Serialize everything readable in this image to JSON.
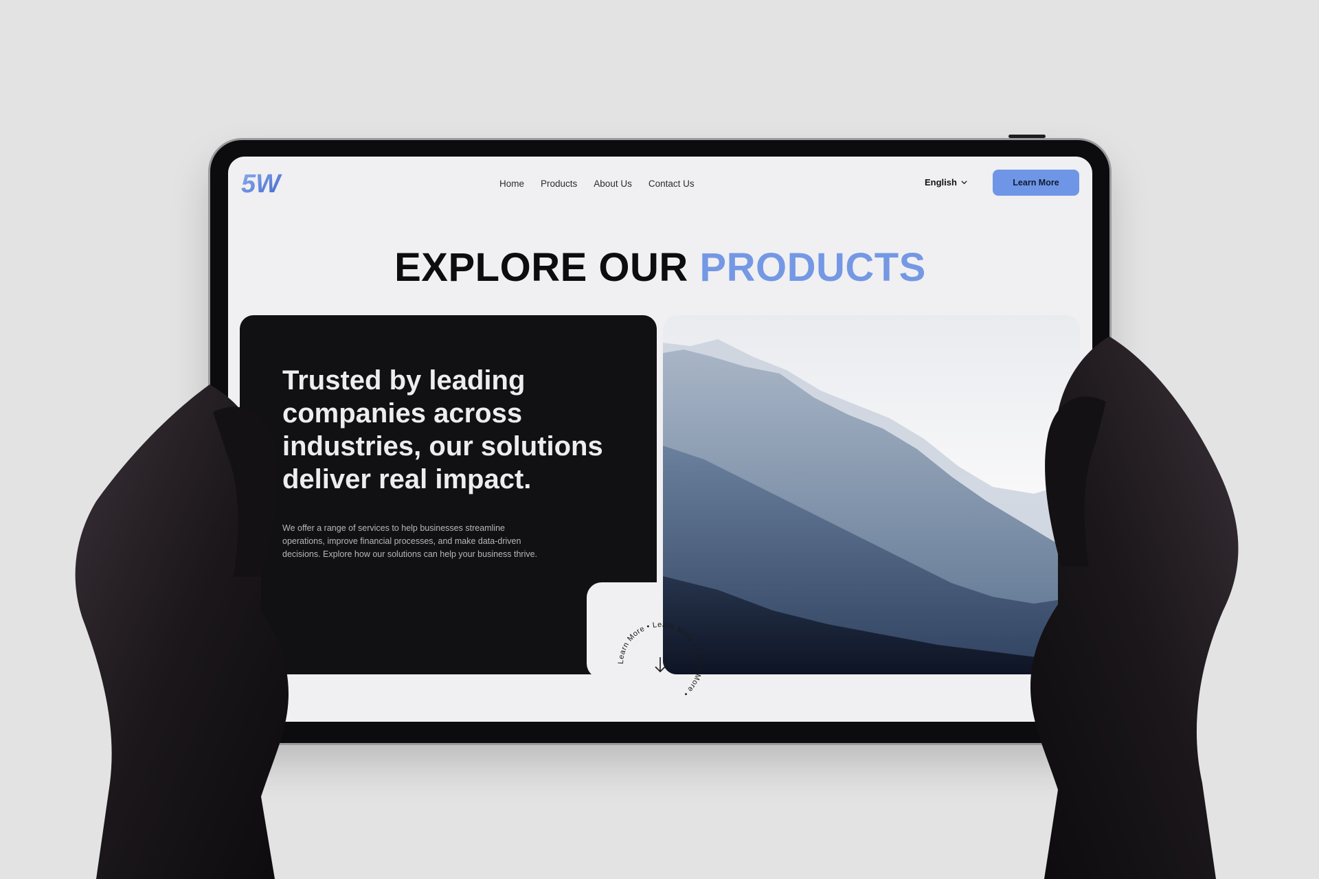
{
  "brand": {
    "logo_text": "5W",
    "accent": "#6f96e6"
  },
  "nav": {
    "items": [
      {
        "label": "Home"
      },
      {
        "label": "Products"
      },
      {
        "label": "About Us"
      },
      {
        "label": "Contact Us"
      }
    ]
  },
  "language": {
    "selected": "English"
  },
  "header_cta": {
    "label": "Learn More"
  },
  "hero": {
    "heading_main": "EXPLORE OUR ",
    "heading_accent": "PRODUCTS"
  },
  "card": {
    "title": "Trusted by leading companies across industries, our solutions deliver real impact.",
    "description": "We offer a range of services to help businesses streamline operations, improve financial processes, and make data-driven decisions. Explore how our solutions can help your business thrive."
  },
  "scroll_badge": {
    "ring_text": "Learn More • Learn More • Learn More • "
  }
}
